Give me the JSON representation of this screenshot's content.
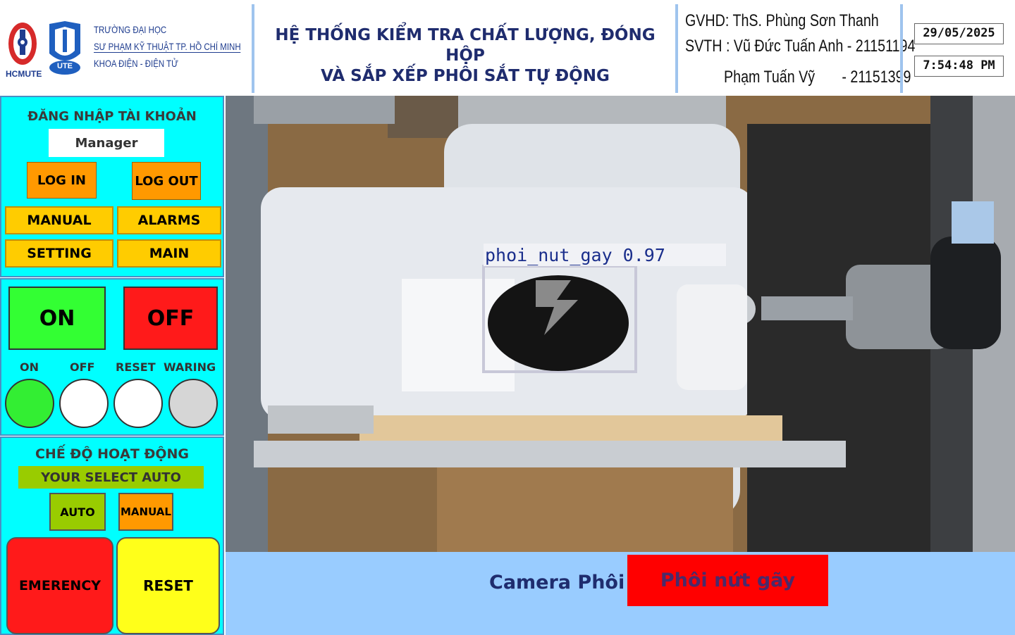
{
  "header": {
    "logo1_text": "HCMUTE",
    "logo2_text": "UTE",
    "school_line1": "TRƯỜNG ĐẠI HỌC",
    "school_line2": "SƯ PHẠM KỸ THUẬT TP. HỒ CHÍ MINH",
    "school_line3": "KHOA ĐIỆN - ĐIỆN TỬ",
    "title_line1": "HỆ THỐNG KIỂM TRA CHẤT LƯỢNG, ĐÓNG HỘP",
    "title_line2": "VÀ SẮP XẾP PHÔI SẮT TỰ ĐỘNG",
    "gvhd": "GVHD: ThS. Phùng Sơn Thanh",
    "svth1": "SVTH : Vũ Đức Tuấn Anh - 21151194",
    "svth2": "Phạm Tuấn Vỹ       - 21151399",
    "date": "29/05/2025",
    "time": "7:54:48 PM"
  },
  "login": {
    "title": "ĐĂNG NHẬP TÀI KHOẢN",
    "user": "Manager",
    "login_label": "LOG IN",
    "logout_label": "LOG OUT",
    "nav": [
      "MANUAL",
      "ALARMS",
      "SETTING",
      "MAIN"
    ]
  },
  "control": {
    "on_label": "ON",
    "off_label": "OFF",
    "lamp_labels": [
      "ON",
      "OFF",
      "RESET",
      "WARING"
    ]
  },
  "mode": {
    "title": "CHẾ ĐỘ HOẠT ĐỘNG",
    "status": "YOUR SELECT AUTO",
    "auto_label": "AUTO",
    "manual_label": "MANUAL",
    "emergency_label": "EMERENCY",
    "reset_label": "RESET"
  },
  "camera": {
    "detection_label": "phoi_nut_gay 0.97",
    "caption": "Camera Phôi",
    "result": "Phôi nứt gãy"
  },
  "colors": {
    "panel_bg": "#00ffff",
    "on_green": "#33ff33",
    "off_red": "#ff1a1a",
    "result_red": "#ff0000",
    "bottom_bar": "#99ccff"
  }
}
